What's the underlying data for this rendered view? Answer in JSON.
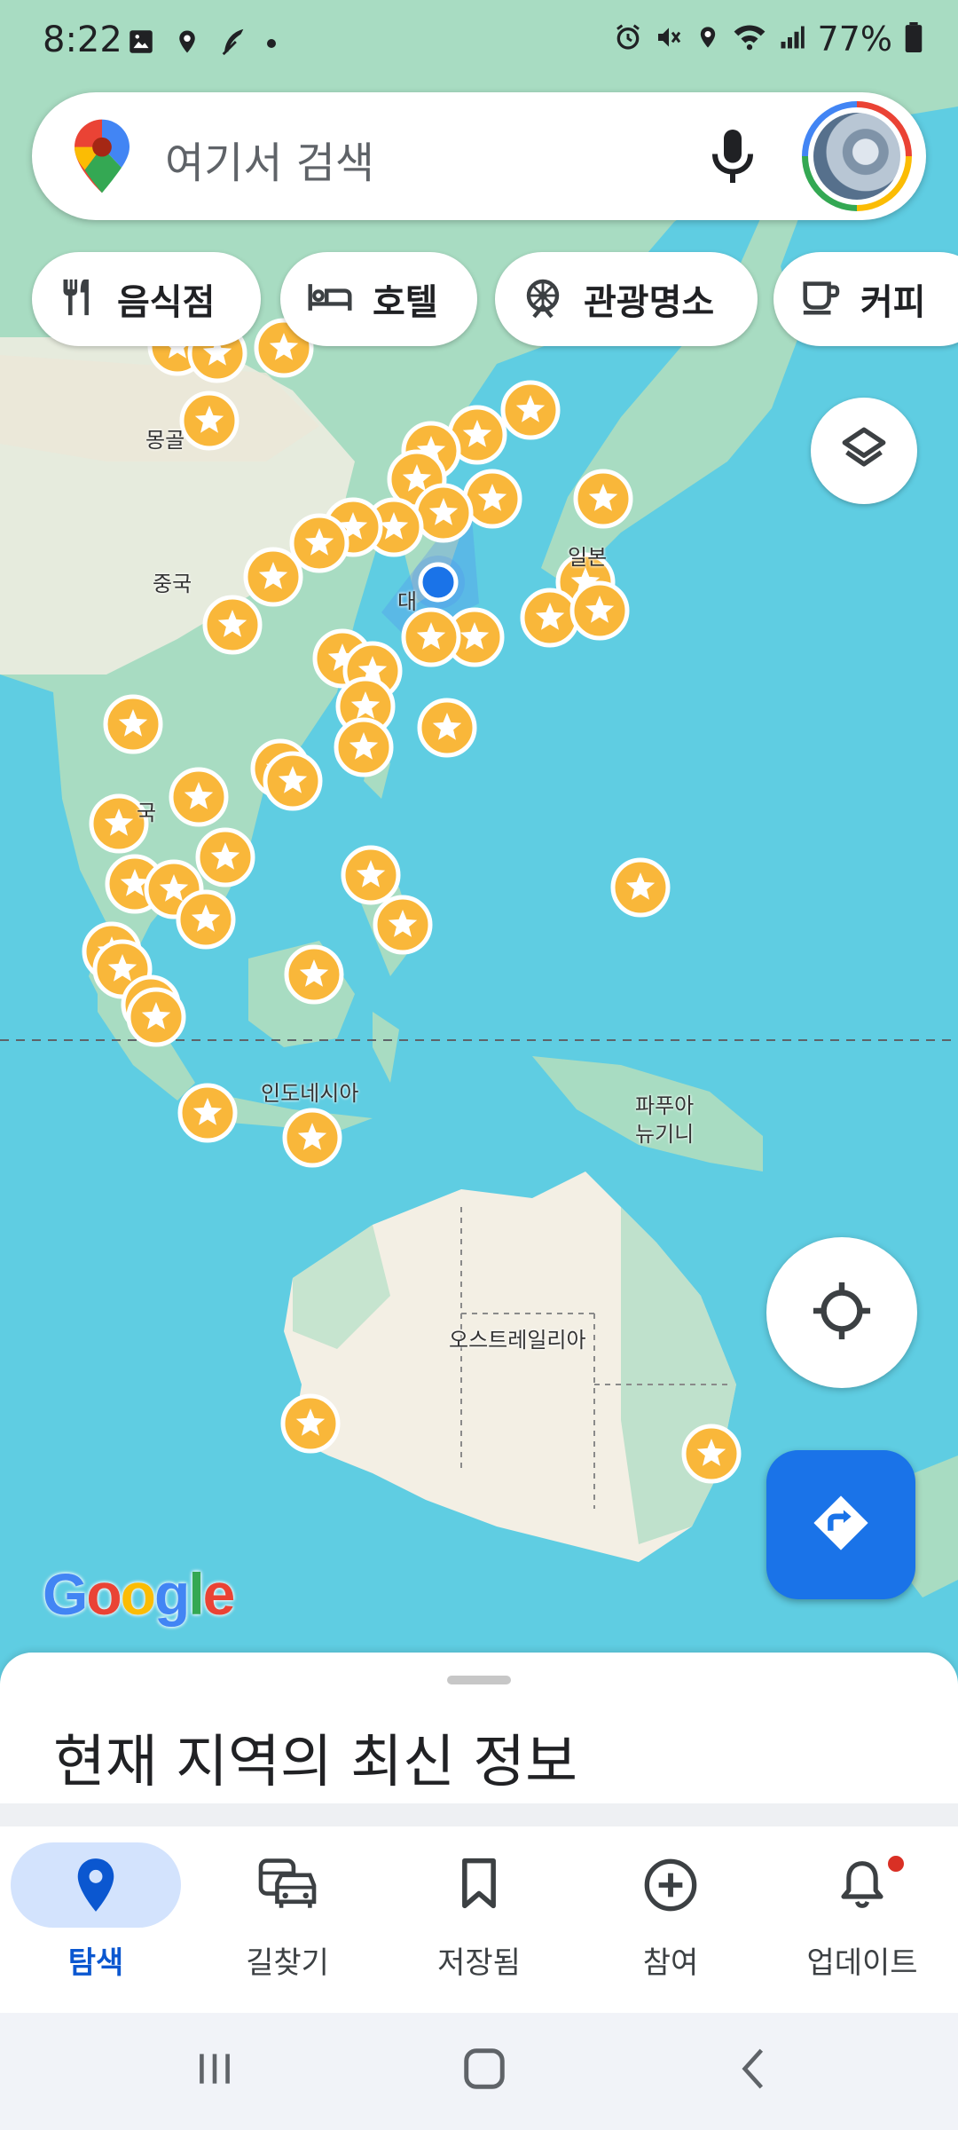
{
  "status_bar": {
    "time": "8:22",
    "battery": "77%",
    "left_icons": [
      "gallery-icon",
      "location-icon",
      "feather-icon",
      "dot-icon"
    ],
    "right_icons": [
      "alarm-icon",
      "mute-icon",
      "location-icon",
      "wifi-icon",
      "signal-icon",
      "battery-icon"
    ]
  },
  "search": {
    "placeholder": "여기서 검색",
    "left_icon": "maps-pin-icon",
    "mic_icon": "mic-icon",
    "avatar_icon": "account-avatar"
  },
  "chips": [
    {
      "label": "음식점",
      "icon": "restaurant-icon"
    },
    {
      "label": "호텔",
      "icon": "hotel-icon"
    },
    {
      "label": "관광명소",
      "icon": "attraction-icon"
    },
    {
      "label": "커피",
      "icon": "coffee-icon"
    }
  ],
  "map": {
    "labels": {
      "mongolia": "몽골",
      "china": "중국",
      "japan": "일본",
      "korea": "대",
      "thailand": "국",
      "indonesia": "인도네시아",
      "png_line1": "파푸아",
      "png_line2": "뉴기니",
      "australia": "오스트레일리아"
    },
    "marker_icon": "star-marker-icon",
    "current_location_icon": "my-location-dot"
  },
  "fabs": {
    "layers": "layers-icon",
    "locate": "crosshair-icon",
    "directions": "directions-icon"
  },
  "google_logo": {
    "G": "G",
    "o1": "o",
    "o2": "o",
    "g": "g",
    "l": "l",
    "e": "e"
  },
  "colors": {
    "blue": "#1a73e8",
    "red": "#ea4335",
    "yellow": "#fbbc04",
    "green": "#34a853",
    "marker": "#f9b73a",
    "water": "#5fcde2",
    "land": "#f3efe4"
  },
  "sheet": {
    "title": "현재 지역의 최신 정보"
  },
  "bottom_nav": [
    {
      "label": "탐색",
      "icon": "explore-pin-icon",
      "active": true
    },
    {
      "label": "길찾기",
      "icon": "commute-car-icon",
      "active": false
    },
    {
      "label": "저장됨",
      "icon": "bookmark-icon",
      "active": false
    },
    {
      "label": "참여",
      "icon": "add-circle-icon",
      "active": false
    },
    {
      "label": "업데이트",
      "icon": "bell-icon",
      "active": false,
      "badge": true
    }
  ],
  "system_nav": [
    "recents-icon",
    "home-icon",
    "back-icon"
  ]
}
